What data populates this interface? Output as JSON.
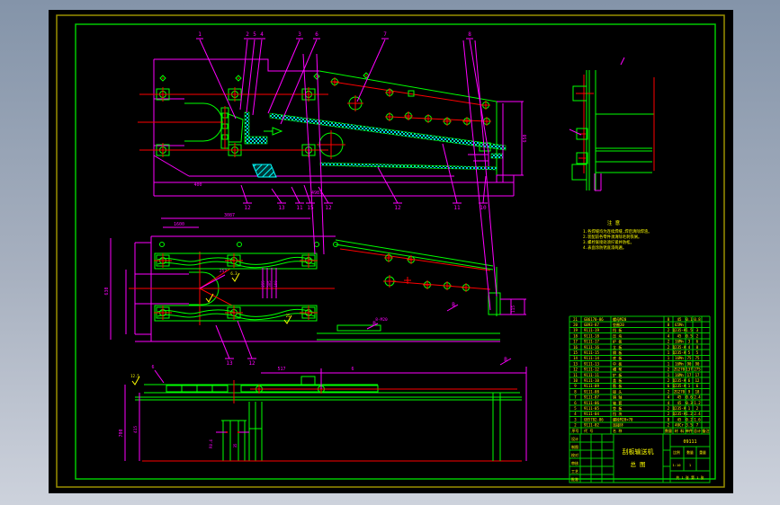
{
  "window": {
    "surround_top": "#8494a9",
    "surround_bottom": "#cdd2dc",
    "canvas_bg": "#000000"
  },
  "frame": {
    "outer_color": "#9a8f00",
    "inner_color": "#00c800"
  },
  "palette": {
    "outline": "#ff00ff",
    "geometry": "#00ff00",
    "centerline": "#ff0000",
    "hatch": "#00ffff",
    "text": "#ffff00"
  },
  "notes": {
    "heading": "注 意",
    "lines": [
      "1.各焊缝均为连续焊缝,焊后清除焊渣。",
      "2.装配前各零件须清除毛刺铁屑。",
      "3.螺栓联接处须拧紧并防松。",
      "4.表面涂防锈底漆两遍。"
    ]
  },
  "balloons": {
    "top": [
      "1",
      "2",
      "5",
      "4",
      "3",
      "6",
      "7",
      "8"
    ],
    "bottom": [
      "12",
      "13",
      "11",
      "15",
      "12",
      "12",
      "11",
      "10"
    ],
    "plan": [
      "13",
      "12"
    ]
  },
  "dims": {
    "v1_len": "400",
    "v1_total": "4987",
    "v1_height": "650",
    "v2_len1": "3087",
    "v2_len2": "1600",
    "v2_width": "630",
    "v2_diag": "257",
    "v2_m1": "255",
    "v2_m2": "305",
    "v2_m3": "160",
    "v2_right": "115",
    "v2_bolt": "8-M20",
    "v3_h1": "700",
    "v3_h2": "415",
    "v3_top1": "517",
    "v3_top2": "6",
    "v3_r": "R0.4",
    "v3_t": "35",
    "v3_lead": "6",
    "section_b": "B"
  },
  "roughness": {
    "r1": "12.5",
    "r2": "6.3",
    "r3": "25"
  },
  "bom": {
    "headers": [
      "序号",
      "代  号",
      "名  称",
      "数量",
      "材  料",
      "单件",
      "总计",
      "备注"
    ],
    "rows": [
      [
        "21",
        "GB6170-86",
        "螺母M20",
        "8",
        "45",
        "0.1",
        "0.8",
        ""
      ],
      [
        "20",
        "GB93-87",
        "垫圈20",
        "8",
        "65Mn",
        "",
        "",
        ""
      ],
      [
        "19",
        "9111-19",
        "挡 板",
        "2",
        "Q235-A",
        "1.5",
        "3",
        ""
      ],
      [
        "18",
        "9111-18",
        "压 块",
        "4",
        "45",
        "0.5",
        "2",
        ""
      ],
      [
        "17",
        "9111-17",
        "护 板",
        "2",
        "16Mn",
        "3",
        "6",
        ""
      ],
      [
        "16",
        "9111-16",
        "立 板",
        "2",
        "Q235-A",
        "4",
        "8",
        ""
      ],
      [
        "15",
        "9111-15",
        "隔 板",
        "1",
        "Q235-A",
        "5",
        "5",
        ""
      ],
      [
        "14",
        "9111-14",
        "底 板",
        "1",
        "16Mn",
        "75",
        "75",
        ""
      ],
      [
        "13",
        "9111-13",
        "中 板",
        "1",
        "16Mn",
        "90",
        "90",
        ""
      ],
      [
        "12",
        "9111-12",
        "槽 帮",
        "2",
        "ZG270",
        "137",
        "275",
        ""
      ],
      [
        "11",
        "9111-11",
        "铲 板",
        "1",
        "16Mn",
        "17",
        "17",
        ""
      ],
      [
        "10",
        "9111-10",
        "盖 板",
        "2",
        "Q235-A",
        "6",
        "12",
        ""
      ],
      [
        "9",
        "9111-09",
        "筋 板",
        "6",
        "Q235-A",
        "1",
        "6",
        ""
      ],
      [
        "8",
        "9111-08",
        "接 头",
        "2",
        "ZG270",
        "9",
        "18",
        ""
      ],
      [
        "7",
        "9111-07",
        "销 轴",
        "4",
        "45",
        "0.6",
        "2.4",
        ""
      ],
      [
        "6",
        "9111-06",
        "轴 套",
        "4",
        "45",
        "0.3",
        "1.2",
        ""
      ],
      [
        "5",
        "9111-05",
        "垫 板",
        "2",
        "Q235-A",
        "1",
        "2",
        ""
      ],
      [
        "4",
        "9111-04",
        "挡 块",
        "2",
        "Q235-A",
        "1.2",
        "2.4",
        ""
      ],
      [
        "3",
        "GB5782-86",
        "螺栓M20×70",
        "8",
        "45",
        "0.2",
        "1.6",
        ""
      ],
      [
        "2",
        "9111-02",
        "连接环",
        "2",
        "40Cr",
        "3.5",
        "7",
        ""
      ]
    ]
  },
  "titleblock": {
    "title_line1": "刮板输送机",
    "title_line2": "总 图",
    "drawing_no": "09111",
    "left_rows": [
      "设计",
      "制图",
      "校对",
      "审核",
      "工艺",
      "批准"
    ],
    "scale_label": "比例",
    "scale": "1:10",
    "qty_label": "数量",
    "qty": "1",
    "weight_label": "重量",
    "weight": "",
    "sheet": "共 1 张  第 1 张"
  }
}
